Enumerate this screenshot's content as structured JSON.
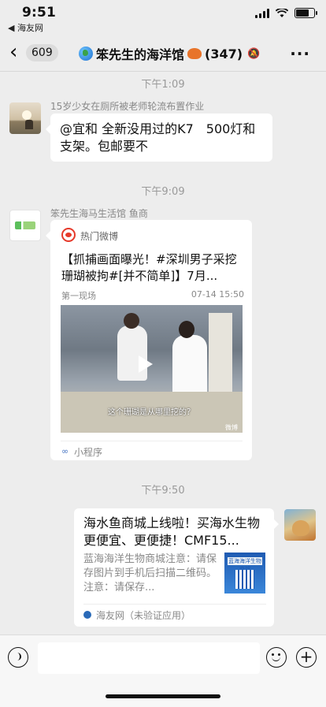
{
  "status_bar": {
    "time": "9:51",
    "back_app": "◀ 海友网"
  },
  "nav": {
    "back_icon": "chevron-left-icon",
    "unread_count": "609",
    "title": "笨先生的海洋馆",
    "member_count": "(347)",
    "more_icon": "more-icon"
  },
  "messages": [
    {
      "time": "下午1:09"
    },
    {
      "sender": "15岁少女在厕所被老师轮流布置作业",
      "text": "@宜和 全新没用过的K7　500灯和支架。包邮要不"
    },
    {
      "time": "下午9:09"
    },
    {
      "sender": "笨先生海马生活馆 鱼商",
      "card": {
        "source": "热门微博",
        "title": "【抓捕画面曝光！#深圳男子采挖珊瑚被拘#[并不简单]】7月...",
        "sub": "第一现场",
        "date": "07-14 15:50",
        "video_caption": "这个珊瑚是从哪里挖的？",
        "video_logo": "微博",
        "mini_program_label": "小程序"
      }
    },
    {
      "time": "下午9:50"
    },
    {
      "link_card": {
        "title": "海水鱼商城上线啦！买海水生物更便宜、更便捷！CMF15...",
        "desc": "蓝海海洋生物商城注意：请保存图片到手机后扫描二维码。注意：请保存...",
        "thumb_text": "蓝海海洋生物商城",
        "app_label": "海友网（未验证应用）"
      }
    }
  ],
  "input_bar": {
    "placeholder": ""
  }
}
